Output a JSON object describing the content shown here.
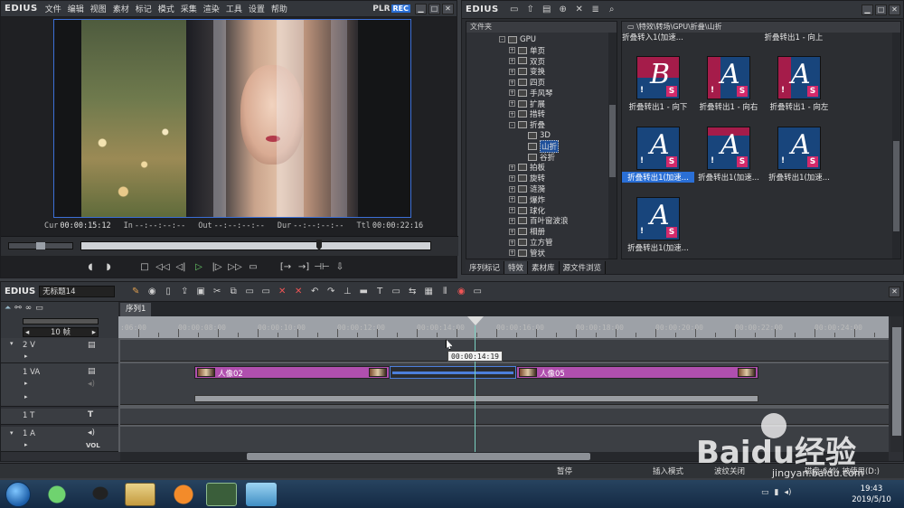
{
  "app": {
    "logo": "EDIUS",
    "menu": [
      "文件",
      "编辑",
      "视图",
      "素材",
      "标记",
      "模式",
      "采集",
      "渲染",
      "工具",
      "设置",
      "帮助"
    ],
    "plr": "PLR",
    "rec": "REC"
  },
  "preview": {
    "cur_label": "Cur",
    "cur": "00:00:15:12",
    "in_label": "In",
    "in": "--:--:--:--",
    "out_label": "Out",
    "out": "--:--:--:--",
    "dur_label": "Dur",
    "dur": "--:--:--:--",
    "ttl_label": "Ttl",
    "ttl": "00:00:22:16"
  },
  "library": {
    "logo": "EDIUS",
    "folder_header": "文件夹",
    "path": "\\特效\\转场\\GPU\\折叠\\山折",
    "tree": [
      {
        "label": "GPU",
        "indent": 0,
        "exp": "-"
      },
      {
        "label": "单页",
        "indent": 1,
        "exp": "+"
      },
      {
        "label": "双页",
        "indent": 1,
        "exp": "+"
      },
      {
        "label": "变换",
        "indent": 1,
        "exp": "+"
      },
      {
        "label": "四页",
        "indent": 1,
        "exp": "+"
      },
      {
        "label": "手风琴",
        "indent": 1,
        "exp": "+"
      },
      {
        "label": "扩展",
        "indent": 1,
        "exp": "+"
      },
      {
        "label": "措转",
        "indent": 1,
        "exp": "+"
      },
      {
        "label": "折叠",
        "indent": 1,
        "exp": "-"
      },
      {
        "label": "3D",
        "indent": 2,
        "exp": ""
      },
      {
        "label": "山折",
        "indent": 2,
        "exp": "",
        "selected": true
      },
      {
        "label": "谷折",
        "indent": 2,
        "exp": ""
      },
      {
        "label": "拍板",
        "indent": 1,
        "exp": "+"
      },
      {
        "label": "旋转",
        "indent": 1,
        "exp": "+"
      },
      {
        "label": "涟漪",
        "indent": 1,
        "exp": "+"
      },
      {
        "label": "爆炸",
        "indent": 1,
        "exp": "+"
      },
      {
        "label": "球化",
        "indent": 1,
        "exp": "+"
      },
      {
        "label": "百叶窗波浪",
        "indent": 1,
        "exp": "+"
      },
      {
        "label": "相册",
        "indent": 1,
        "exp": "+"
      },
      {
        "label": "立方管",
        "indent": 1,
        "exp": "+"
      },
      {
        "label": "管状",
        "indent": 1,
        "exp": "+"
      }
    ],
    "top_labels": [
      "折叠转入1(加速...",
      "折叠转出1 - 向上"
    ],
    "thumbs": [
      {
        "label": "折叠转出1 - 向下",
        "letter": "B"
      },
      {
        "label": "折叠转出1 - 向右",
        "letter": "A"
      },
      {
        "label": "折叠转出1 - 向左",
        "letter": "A"
      },
      {
        "label": "折叠转出1(加速...",
        "letter": "A",
        "selected": true
      },
      {
        "label": "折叠转出1(加速...",
        "letter": "A"
      },
      {
        "label": "折叠转出1(加速...",
        "letter": "A"
      },
      {
        "label": "折叠转出1(加速...",
        "letter": "A"
      }
    ],
    "tabs": [
      "序列标记",
      "特效",
      "素材库",
      "源文件浏览"
    ]
  },
  "timeline": {
    "logo": "EDIUS",
    "project_name": "无标题14",
    "sequence_tab": "序列1",
    "zoom": "10 帧",
    "ruler": [
      "00:00:08:00",
      "00:00:10:00",
      "00:00:12:00",
      "00:00:14:00",
      "00:00:16:00",
      "00:00:18:00",
      "00:00:20:00",
      "00:00:22:00",
      "00:00:24:00"
    ],
    "ruler_first": ":06:00",
    "tooltip": "00:00:14:19",
    "tracks": {
      "v2": "2 V",
      "va1": "1 VA",
      "t1": "1 T",
      "a1": "1 A",
      "vol": "VOL"
    },
    "clips": [
      {
        "name": "人像02"
      },
      {
        "name": "人像05"
      }
    ]
  },
  "status": {
    "pause": "暂停",
    "insert": "插入模式",
    "ripple": "波纹关闭",
    "disk": "磁盘:64% 被使用(D:)"
  },
  "taskbar": {
    "time": "19:43",
    "date": "2019/5/10"
  },
  "watermark": {
    "brand": "Baidu经验",
    "url": "jingyan.baidu.com"
  }
}
